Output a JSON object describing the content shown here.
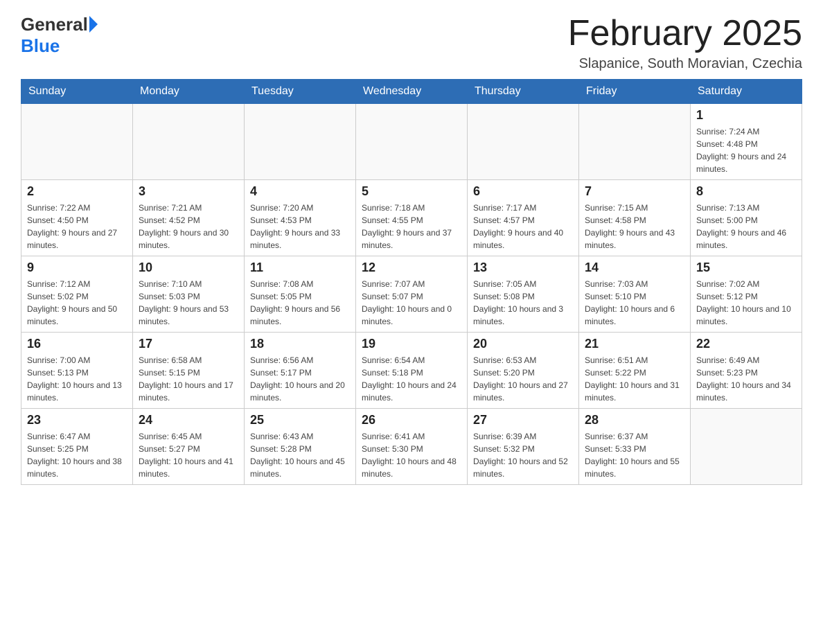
{
  "header": {
    "logo_general": "General",
    "logo_blue": "Blue",
    "month_title": "February 2025",
    "location": "Slapanice, South Moravian, Czechia"
  },
  "days_of_week": [
    "Sunday",
    "Monday",
    "Tuesday",
    "Wednesday",
    "Thursday",
    "Friday",
    "Saturday"
  ],
  "weeks": [
    [
      {
        "day": "",
        "info": ""
      },
      {
        "day": "",
        "info": ""
      },
      {
        "day": "",
        "info": ""
      },
      {
        "day": "",
        "info": ""
      },
      {
        "day": "",
        "info": ""
      },
      {
        "day": "",
        "info": ""
      },
      {
        "day": "1",
        "info": "Sunrise: 7:24 AM\nSunset: 4:48 PM\nDaylight: 9 hours and 24 minutes."
      }
    ],
    [
      {
        "day": "2",
        "info": "Sunrise: 7:22 AM\nSunset: 4:50 PM\nDaylight: 9 hours and 27 minutes."
      },
      {
        "day": "3",
        "info": "Sunrise: 7:21 AM\nSunset: 4:52 PM\nDaylight: 9 hours and 30 minutes."
      },
      {
        "day": "4",
        "info": "Sunrise: 7:20 AM\nSunset: 4:53 PM\nDaylight: 9 hours and 33 minutes."
      },
      {
        "day": "5",
        "info": "Sunrise: 7:18 AM\nSunset: 4:55 PM\nDaylight: 9 hours and 37 minutes."
      },
      {
        "day": "6",
        "info": "Sunrise: 7:17 AM\nSunset: 4:57 PM\nDaylight: 9 hours and 40 minutes."
      },
      {
        "day": "7",
        "info": "Sunrise: 7:15 AM\nSunset: 4:58 PM\nDaylight: 9 hours and 43 minutes."
      },
      {
        "day": "8",
        "info": "Sunrise: 7:13 AM\nSunset: 5:00 PM\nDaylight: 9 hours and 46 minutes."
      }
    ],
    [
      {
        "day": "9",
        "info": "Sunrise: 7:12 AM\nSunset: 5:02 PM\nDaylight: 9 hours and 50 minutes."
      },
      {
        "day": "10",
        "info": "Sunrise: 7:10 AM\nSunset: 5:03 PM\nDaylight: 9 hours and 53 minutes."
      },
      {
        "day": "11",
        "info": "Sunrise: 7:08 AM\nSunset: 5:05 PM\nDaylight: 9 hours and 56 minutes."
      },
      {
        "day": "12",
        "info": "Sunrise: 7:07 AM\nSunset: 5:07 PM\nDaylight: 10 hours and 0 minutes."
      },
      {
        "day": "13",
        "info": "Sunrise: 7:05 AM\nSunset: 5:08 PM\nDaylight: 10 hours and 3 minutes."
      },
      {
        "day": "14",
        "info": "Sunrise: 7:03 AM\nSunset: 5:10 PM\nDaylight: 10 hours and 6 minutes."
      },
      {
        "day": "15",
        "info": "Sunrise: 7:02 AM\nSunset: 5:12 PM\nDaylight: 10 hours and 10 minutes."
      }
    ],
    [
      {
        "day": "16",
        "info": "Sunrise: 7:00 AM\nSunset: 5:13 PM\nDaylight: 10 hours and 13 minutes."
      },
      {
        "day": "17",
        "info": "Sunrise: 6:58 AM\nSunset: 5:15 PM\nDaylight: 10 hours and 17 minutes."
      },
      {
        "day": "18",
        "info": "Sunrise: 6:56 AM\nSunset: 5:17 PM\nDaylight: 10 hours and 20 minutes."
      },
      {
        "day": "19",
        "info": "Sunrise: 6:54 AM\nSunset: 5:18 PM\nDaylight: 10 hours and 24 minutes."
      },
      {
        "day": "20",
        "info": "Sunrise: 6:53 AM\nSunset: 5:20 PM\nDaylight: 10 hours and 27 minutes."
      },
      {
        "day": "21",
        "info": "Sunrise: 6:51 AM\nSunset: 5:22 PM\nDaylight: 10 hours and 31 minutes."
      },
      {
        "day": "22",
        "info": "Sunrise: 6:49 AM\nSunset: 5:23 PM\nDaylight: 10 hours and 34 minutes."
      }
    ],
    [
      {
        "day": "23",
        "info": "Sunrise: 6:47 AM\nSunset: 5:25 PM\nDaylight: 10 hours and 38 minutes."
      },
      {
        "day": "24",
        "info": "Sunrise: 6:45 AM\nSunset: 5:27 PM\nDaylight: 10 hours and 41 minutes."
      },
      {
        "day": "25",
        "info": "Sunrise: 6:43 AM\nSunset: 5:28 PM\nDaylight: 10 hours and 45 minutes."
      },
      {
        "day": "26",
        "info": "Sunrise: 6:41 AM\nSunset: 5:30 PM\nDaylight: 10 hours and 48 minutes."
      },
      {
        "day": "27",
        "info": "Sunrise: 6:39 AM\nSunset: 5:32 PM\nDaylight: 10 hours and 52 minutes."
      },
      {
        "day": "28",
        "info": "Sunrise: 6:37 AM\nSunset: 5:33 PM\nDaylight: 10 hours and 55 minutes."
      },
      {
        "day": "",
        "info": ""
      }
    ]
  ]
}
